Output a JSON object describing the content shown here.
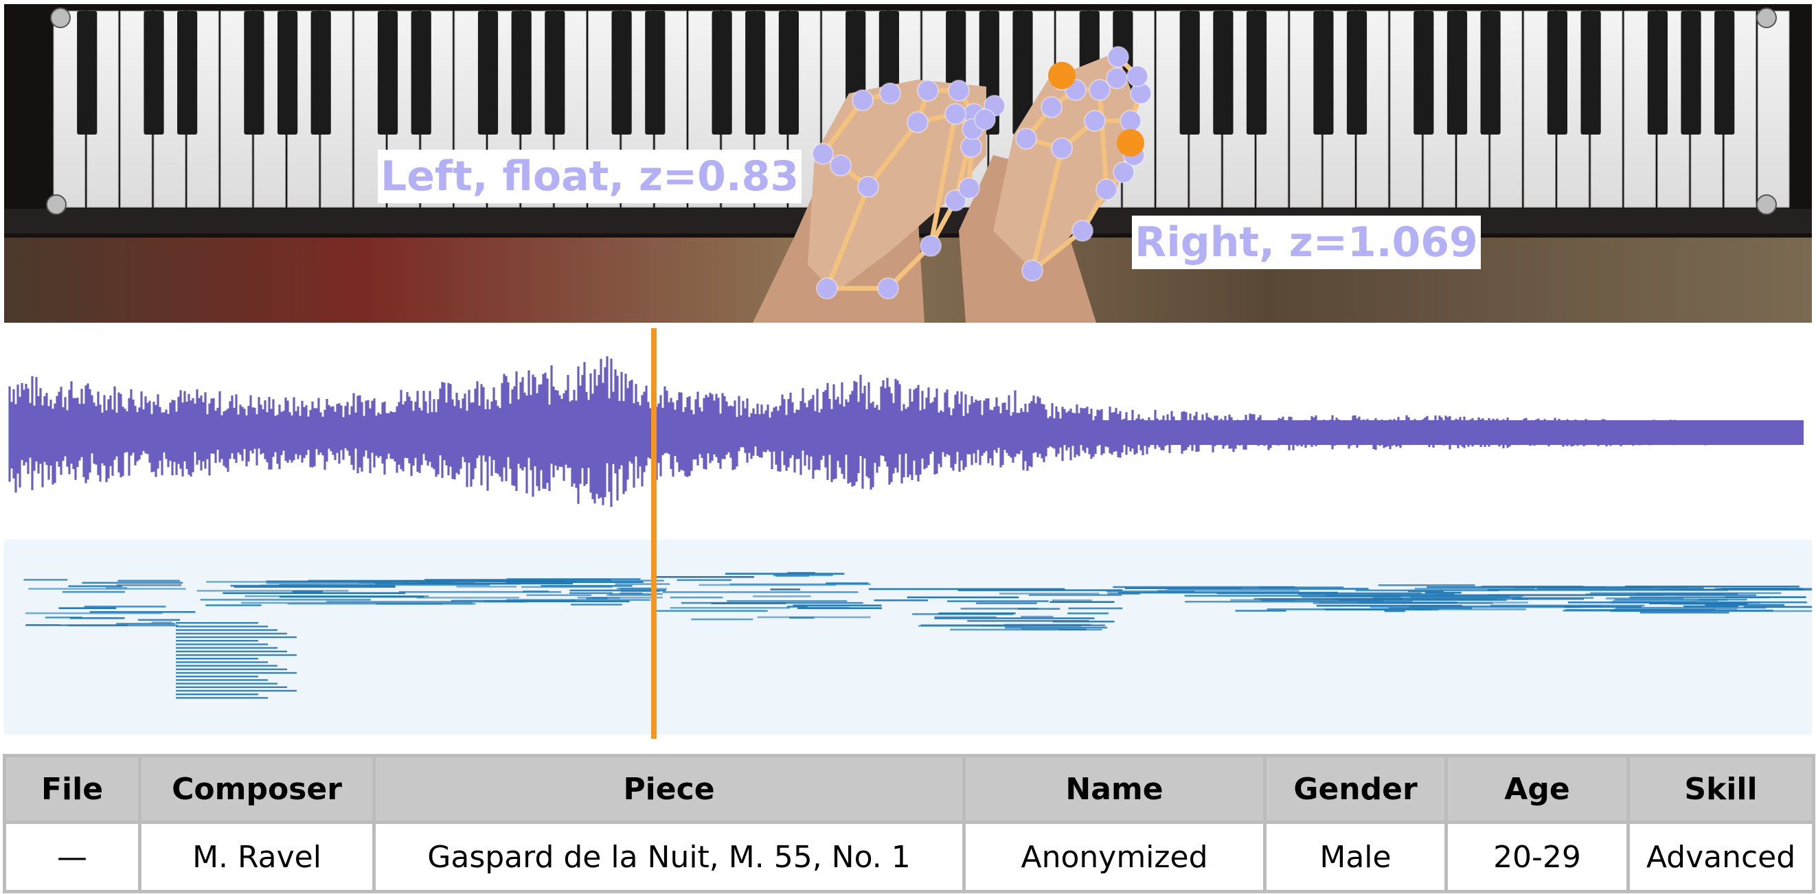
{
  "video": {
    "left_hand_label": "Left, float, z=0.83",
    "right_hand_label": "Right, z=1.069",
    "colors": {
      "landmark": "#b6b2f4",
      "active_landmark": "#f5931d",
      "skeleton": "#f3c27e",
      "label_text": "#b3b0f6"
    }
  },
  "waveform": {
    "color": "#6a5fc1"
  },
  "piano_roll": {
    "color": "#1f77b4",
    "background": "#eef6fc"
  },
  "playhead": {
    "color": "#f5961f"
  },
  "table": {
    "headers": [
      "File",
      "Composer",
      "Piece",
      "Name",
      "Gender",
      "Age",
      "Skill"
    ],
    "row": [
      "—",
      "M. Ravel",
      "Gaspard de la Nuit, M. 55, No. 1",
      "Anonymized",
      "Male",
      "20-29",
      "Advanced"
    ]
  }
}
